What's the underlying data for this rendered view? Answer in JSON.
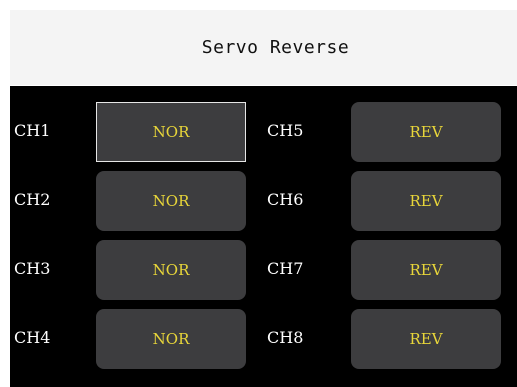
{
  "header": {
    "title": "Servo Reverse"
  },
  "channels": [
    {
      "label": "CH1",
      "value": "NOR"
    },
    {
      "label": "CH2",
      "value": "NOR"
    },
    {
      "label": "CH3",
      "value": "NOR"
    },
    {
      "label": "CH4",
      "value": "NOR"
    },
    {
      "label": "CH5",
      "value": "REV"
    },
    {
      "label": "CH6",
      "value": "REV"
    },
    {
      "label": "CH7",
      "value": "REV"
    },
    {
      "label": "CH8",
      "value": "REV"
    }
  ],
  "selected_channel": "CH1",
  "colors": {
    "panel_background": "#000000",
    "button_background": "#3d3d3f",
    "button_text": "#e8d63a",
    "label_text": "#ffffff",
    "header_background": "#f4f4f4",
    "selected_border": "#e6e6e6"
  }
}
